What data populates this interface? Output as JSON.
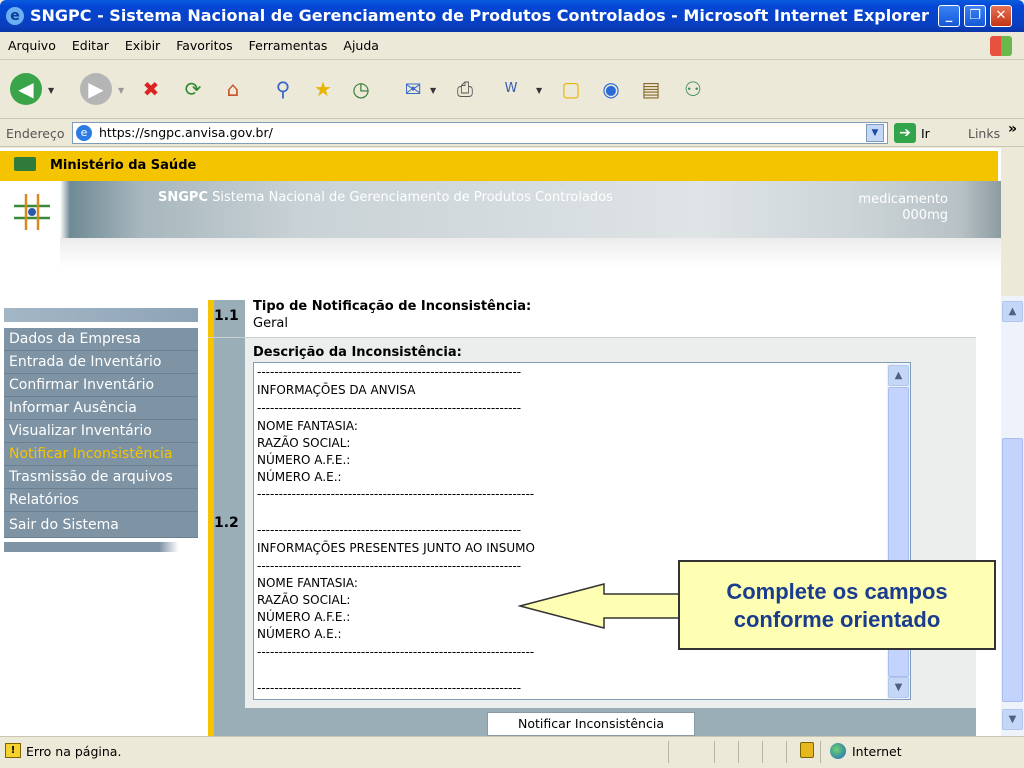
{
  "window": {
    "title": "SNGPC - Sistema Nacional de Gerenciamento de Produtos Controlados - Microsoft Internet Explorer",
    "buttons": {
      "minimize": "_",
      "maximize": "❐",
      "close": "✕"
    }
  },
  "menu": [
    "Arquivo",
    "Editar",
    "Exibir",
    "Favoritos",
    "Ferramentas",
    "Ajuda"
  ],
  "toolbar": {
    "icons": [
      "back-icon",
      "forward-icon",
      "stop-icon",
      "refresh-icon",
      "home-icon",
      "search-icon",
      "favorites-icon",
      "history-icon",
      "mail-icon",
      "print-icon",
      "edit-icon",
      "discuss-icon",
      "messenger-icon",
      "research-icon",
      "media-icon"
    ]
  },
  "address": {
    "label": "Endereço",
    "url": "https://sngpc.anvisa.gov.br/",
    "go_label": "Ir",
    "links_label": "Links",
    "links_chevron": "»"
  },
  "page": {
    "ministry": "Ministério da Saúde",
    "banner_bold": "SNGPC",
    "banner_text": " Sistema Nacional de Gerenciamento de Produtos Controlados",
    "banner_medic_1": "medicamento",
    "banner_medic_2": "000mg"
  },
  "sidebar": {
    "items": [
      {
        "label": "Dados da Empresa",
        "active": false
      },
      {
        "label": "Entrada de Inventário",
        "active": false
      },
      {
        "label": "Confirmar Inventário",
        "active": false
      },
      {
        "label": "Informar Ausência",
        "active": false
      },
      {
        "label": "Visualizar Inventário",
        "active": false
      },
      {
        "label": "Notificar Inconsistência",
        "active": true
      },
      {
        "label": "Trasmissão de arquivos",
        "active": false
      },
      {
        "label": "Relatórios",
        "active": false
      },
      {
        "label": "Sair do Sistema",
        "active": false
      }
    ]
  },
  "form": {
    "n11": "1.1",
    "n12": "1.2",
    "notif_type_label": "Tipo de Notificação de Inconsistência:",
    "notif_type_value": "Geral",
    "desc_label": "Descrição da Inconsistência:",
    "textarea_lines": [
      "-------------------------------------------------------------",
      "INFORMAÇÕES DA ANVISA",
      "-------------------------------------------------------------",
      "NOME FANTASIA:",
      "RAZÃO SOCIAL:",
      "NÚMERO A.F.E.:",
      "NÚMERO A.E.:",
      "----------------------------------------------------------------",
      "",
      "-------------------------------------------------------------",
      "INFORMAÇÕES PRESENTES JUNTO AO INSUMO",
      "-------------------------------------------------------------",
      "NOME FANTASIA:",
      "RAZÃO SOCIAL:",
      "NÚMERO A.F.E.:",
      "NÚMERO A.E.:",
      "----------------------------------------------------------------",
      "",
      "-------------------------------------------------------------"
    ],
    "submit_label": "Notificar Inconsistência"
  },
  "callout": {
    "line1": "Complete os campos",
    "line2": "conforme orientado"
  },
  "status": {
    "text": "Erro na página.",
    "zone": "Internet"
  }
}
